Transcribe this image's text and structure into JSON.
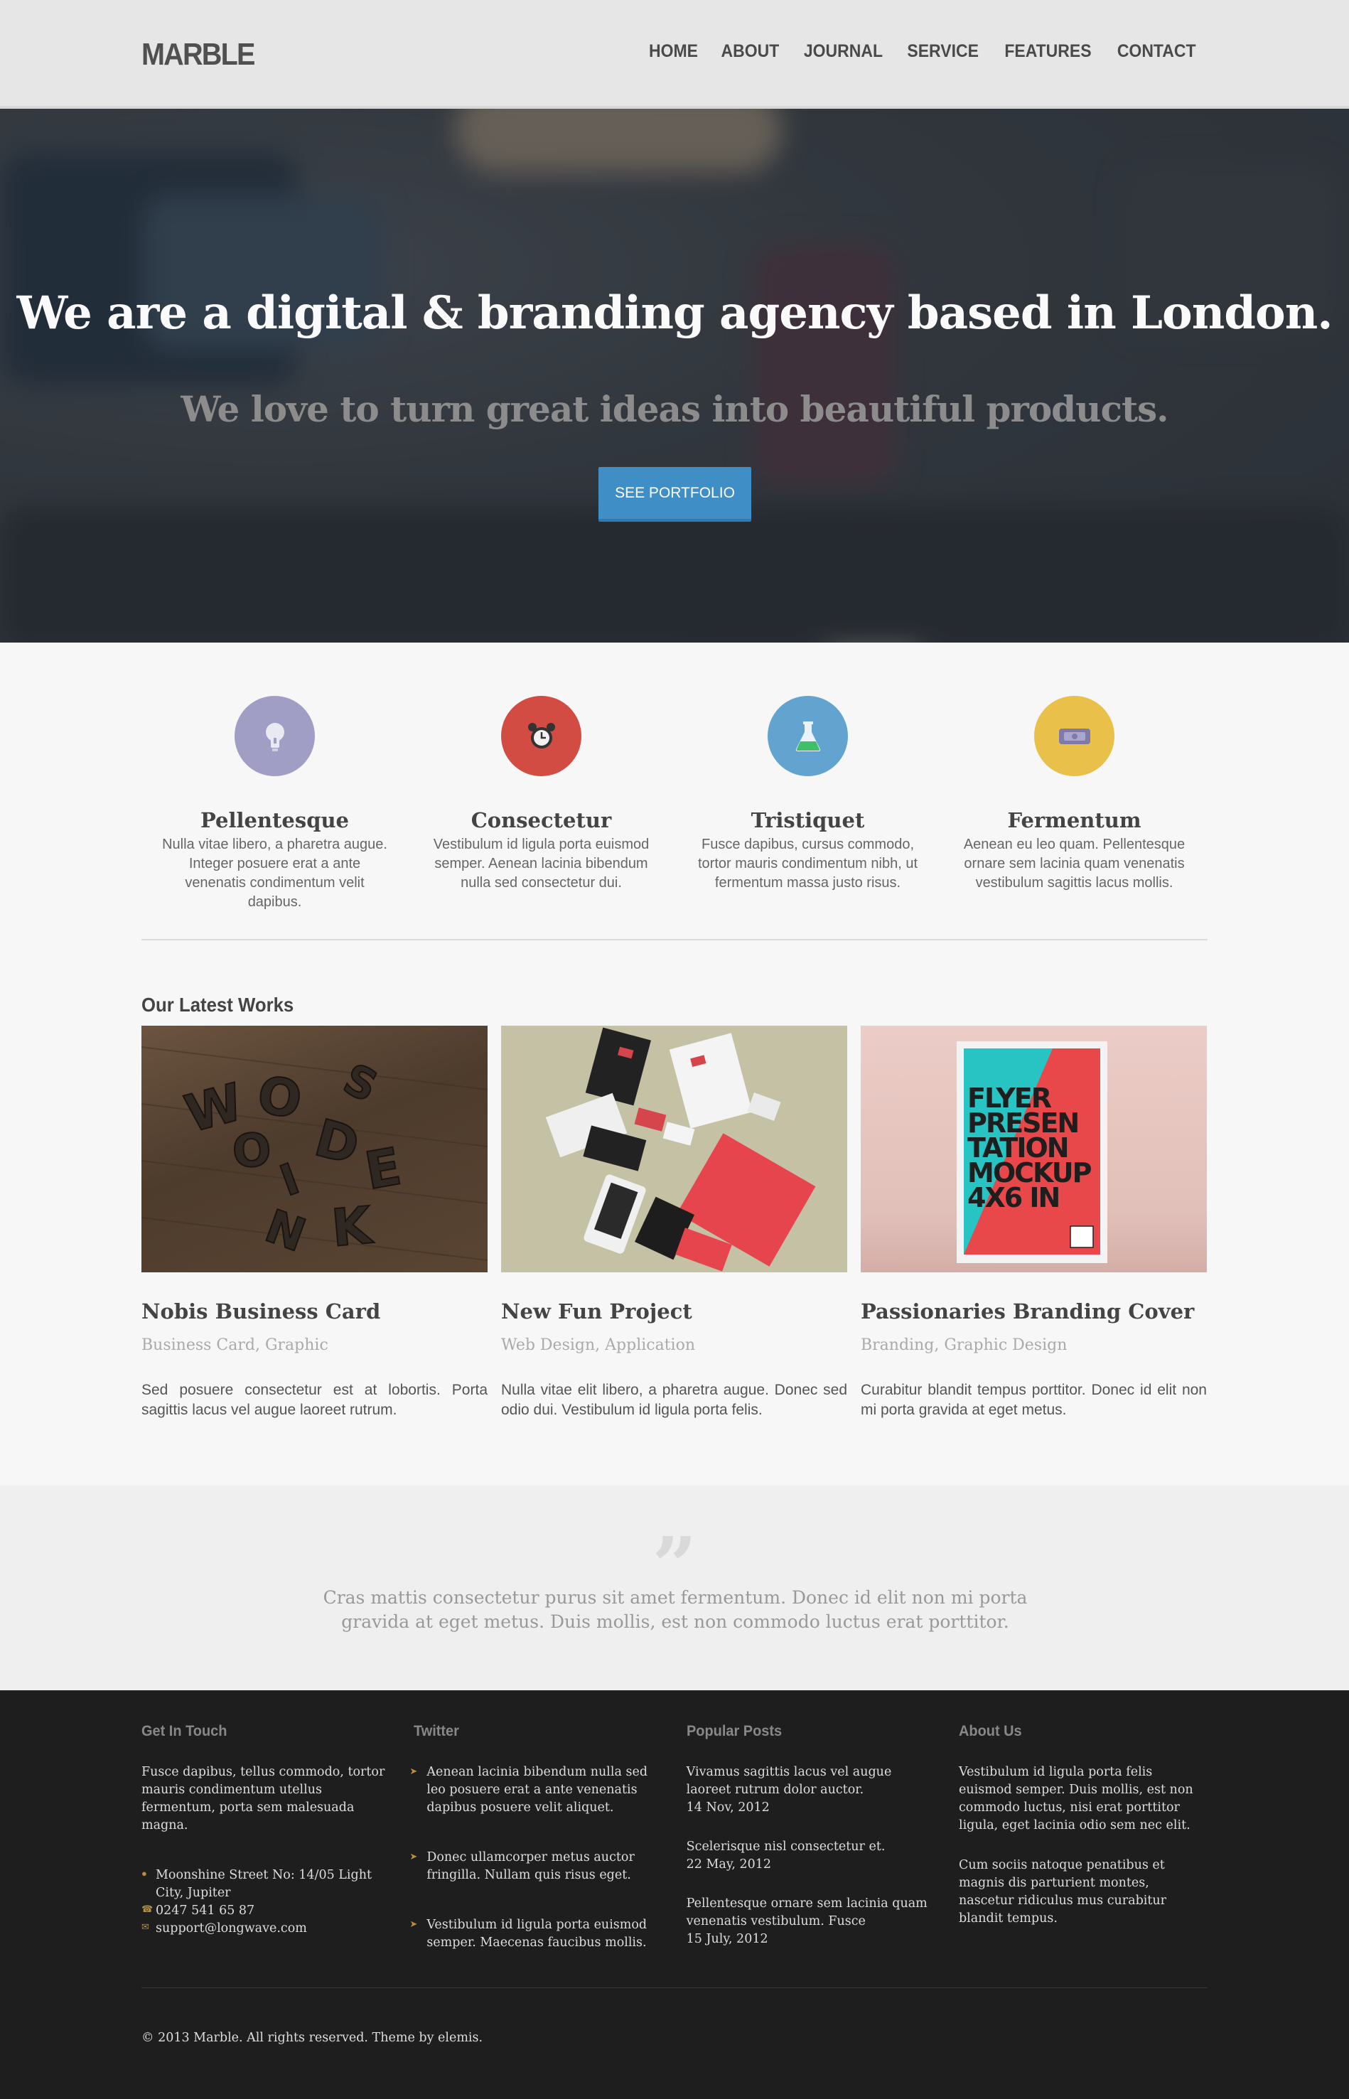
{
  "header": {
    "logo": "MARBLE",
    "nav": [
      "HOME",
      "ABOUT",
      "JOURNAL",
      "SERVICE",
      "FEATURES",
      "CONTACT"
    ]
  },
  "hero": {
    "title": "We are a digital & branding agency based in London.",
    "subtitle": "We love to turn great ideas into beautiful products.",
    "button": "SEE PORTFOLIO"
  },
  "features": [
    {
      "title": "Pellentesque",
      "text": "Nulla vitae libero, a pharetra augue. Integer posuere erat a ante venenatis condimentum velit dapibus.",
      "icon": "lightbulb-icon",
      "color": "#a09ec4"
    },
    {
      "title": "Consectetur",
      "text": "Vestibulum id ligula porta euismod semper. Aenean lacinia bibendum nulla sed consectetur dui.",
      "icon": "alarm-clock-icon",
      "color": "#d24c43"
    },
    {
      "title": "Tristiquet",
      "text": "Fusce dapibus, cursus commodo, tortor mauris condimentum nibh, ut fermentum massa justo risus.",
      "icon": "flask-icon",
      "color": "#62a4cf"
    },
    {
      "title": "Fermentum",
      "text": "Aenean eu leo quam. Pellentesque ornare sem lacinia quam venenatis vestibulum sagittis lacus mollis.",
      "icon": "ticket-icon",
      "color": "#e8c04a"
    }
  ],
  "works": {
    "title": "Our Latest Works",
    "items": [
      {
        "title": "Nobis Business Card",
        "category": "Business Card, Graphic",
        "text": "Sed posuere consectetur est at lobortis. Porta sagittis lacus vel augue laoreet rutrum."
      },
      {
        "title": "New Fun Project",
        "category": "Web Design, Application",
        "text": "Nulla vitae elit libero, a pharetra augue. Donec sed odio dui. Vestibulum id ligula porta felis."
      },
      {
        "title": "Passionaries Branding Cover",
        "category": "Branding, Graphic Design",
        "text": "Curabitur blandit tempus porttitor. Donec id elit non mi porta gravida at eget metus."
      }
    ],
    "poster_text": [
      "FLYER",
      "PRESEN",
      "TATION",
      "MOCKUP",
      "4X6 IN"
    ],
    "wood_letters": [
      "W",
      "O",
      "S",
      "O",
      "D",
      "I",
      "E",
      "N",
      "K"
    ]
  },
  "quote": {
    "mark": "”",
    "text": "Cras mattis consectetur purus sit amet fermentum. Donec id elit non mi porta gravida at eget metus. Duis mollis, est non commodo luctus erat porttitor."
  },
  "footer": {
    "get_in_touch": {
      "title": "Get In Touch",
      "text": "Fusce dapibus, tellus commodo, tortor mauris condimentum utellus fermentum, porta sem malesuada magna.",
      "address": "Moonshine Street No: 14/05 Light City, Jupiter",
      "phone": "0247 541 65 87",
      "email": "support@longwave.com"
    },
    "twitter": {
      "title": "Twitter",
      "tweets": [
        "Aenean lacinia bibendum nulla sed leo posuere erat a ante venenatis dapibus posuere velit aliquet.",
        "Donec ullamcorper metus auctor fringilla. Nullam quis risus eget.",
        "Vestibulum id ligula porta euismod semper. Maecenas faucibus mollis."
      ]
    },
    "popular_posts": {
      "title": "Popular Posts",
      "posts": [
        {
          "title": "Vivamus sagittis lacus vel augue laoreet rutrum dolor auctor.",
          "date": "14 Nov, 2012"
        },
        {
          "title": "Scelerisque nisl consectetur et.",
          "date": "22 May, 2012"
        },
        {
          "title": "Pellentesque ornare sem lacinia quam venenatis vestibulum. Fusce",
          "date": "15 July, 2012"
        }
      ]
    },
    "about": {
      "title": "About Us",
      "p1": "Vestibulum id ligula porta felis euismod semper. Duis mollis, est non commodo luctus, nisi erat porttitor ligula, eget lacinia odio sem nec elit.",
      "p2": "Cum sociis natoque penatibus et magnis dis parturient montes, nascetur ridiculus mus curabitur blandit tempus."
    },
    "copyright": "© 2013 Marble. All rights reserved. Theme by elemis."
  }
}
